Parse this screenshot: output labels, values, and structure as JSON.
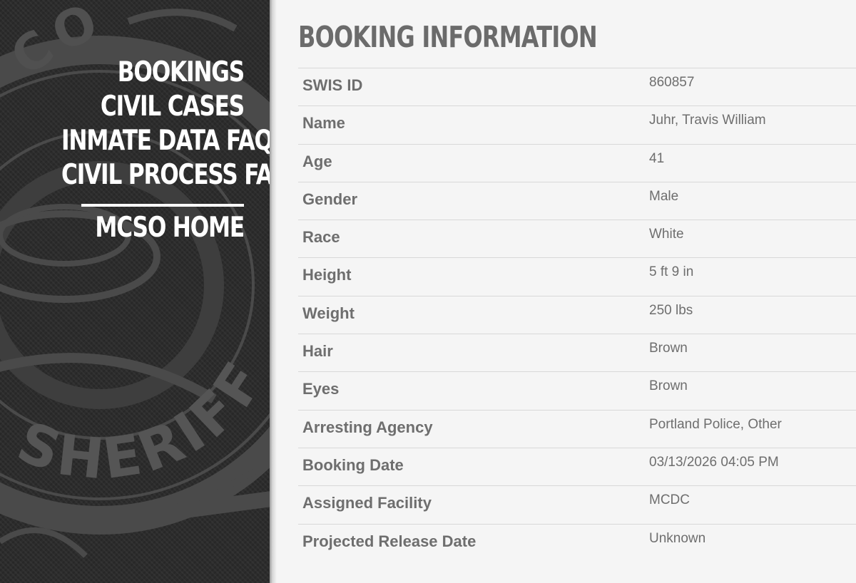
{
  "nav": {
    "items": [
      {
        "label": "BOOKINGS"
      },
      {
        "label": "CIVIL CASES"
      },
      {
        "label": "INMATE DATA FAQ"
      },
      {
        "label": "CIVIL PROCESS FAQ"
      }
    ],
    "home_label": "MCSO HOME"
  },
  "seal": {
    "text_arc": "SHERIFF",
    "text_top": "CO"
  },
  "page_title": "BOOKING INFORMATION",
  "booking": {
    "rows": [
      {
        "label": "SWIS ID",
        "value": "860857"
      },
      {
        "label": "Name",
        "value": "Juhr, Travis William"
      },
      {
        "label": "Age",
        "value": "41"
      },
      {
        "label": "Gender",
        "value": "Male"
      },
      {
        "label": "Race",
        "value": "White"
      },
      {
        "label": "Height",
        "value": "5 ft 9 in"
      },
      {
        "label": "Weight",
        "value": "250 lbs"
      },
      {
        "label": "Hair",
        "value": "Brown"
      },
      {
        "label": "Eyes",
        "value": "Brown"
      },
      {
        "label": "Arresting Agency",
        "value": "Portland Police, Other"
      },
      {
        "label": "Booking Date",
        "value": "03/13/2026 04:05 PM"
      },
      {
        "label": "Assigned Facility",
        "value": "MCDC"
      },
      {
        "label": "Projected Release Date",
        "value": "Unknown"
      }
    ]
  },
  "colors": {
    "sidebar_bg": "#2c2c2c",
    "nav_text": "#ffffff",
    "body_text": "#6e6e6e",
    "main_bg": "#f5f5f5"
  }
}
